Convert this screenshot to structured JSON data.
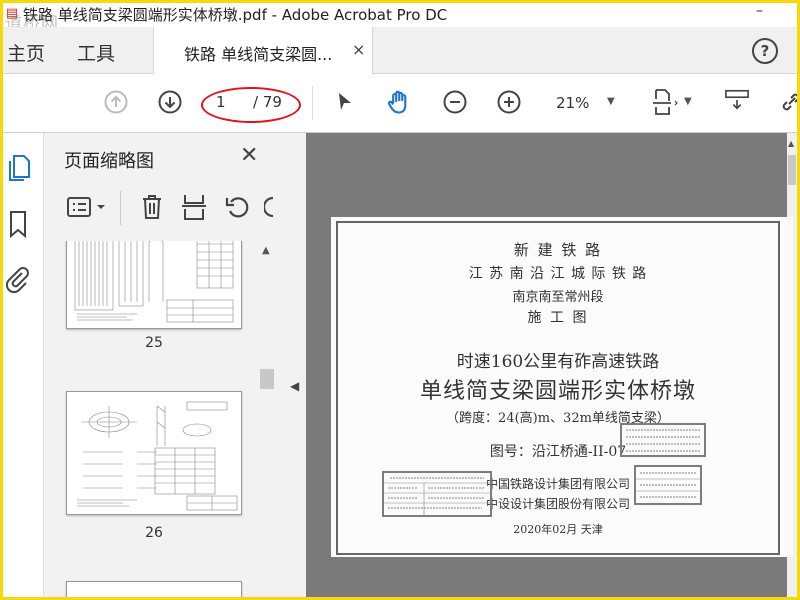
{
  "window": {
    "title": "铁路 单线简支梁圆端形实体桥墩.pdf - Adobe Acrobat Pro DC",
    "watermark": "道桥网",
    "minimize": "–"
  },
  "tabs": {
    "home": "主页",
    "tools": "工具",
    "document": "铁路 单线简支梁圆...",
    "close": "×",
    "help": "?"
  },
  "toolbar": {
    "page_current": "1",
    "page_total": "/ 79",
    "zoom": "21%",
    "annotation_color": "#e0141a"
  },
  "thumbnail_panel": {
    "title": "页面缩略图",
    "close": "✕",
    "pages": [
      {
        "label": "25"
      },
      {
        "label": "26"
      }
    ]
  },
  "document": {
    "lines": [
      "新 建 铁 路",
      "江 苏 南 沿 江 城 际 铁 路",
      "南京南至常州段",
      "施 工 图",
      "时速160公里有砟高速铁路",
      "单线简支梁圆端形实体桥墩",
      "（跨度：24(高)m、32m单线简支梁）",
      "图号：沿江桥通-II-07",
      "中国铁路设计集团有限公司",
      "中设设计集团股份有限公司",
      "2020年02月     天津"
    ]
  }
}
